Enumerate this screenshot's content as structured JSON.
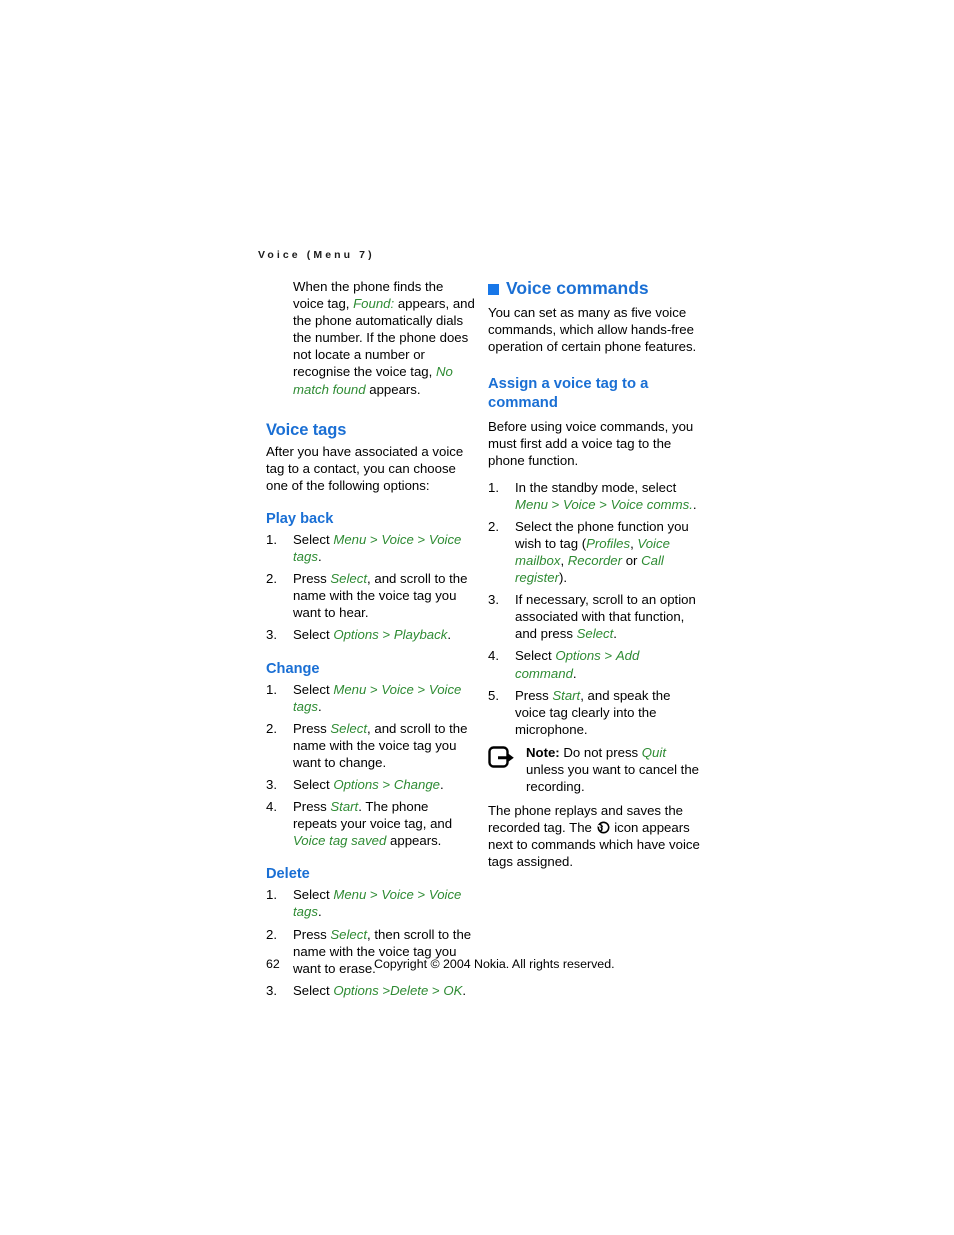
{
  "document": {
    "running_head": "Voice (Menu 7)",
    "page_number": "62",
    "copyright": "Copyright © 2004 Nokia. All rights reserved."
  },
  "colors": {
    "heading_blue": "#1a6fd4",
    "bullet_blue": "#1877e8",
    "ui_term_green": "#2e8b33",
    "body_text": "#000000",
    "page_background": "#ffffff"
  },
  "left_column": {
    "intro_paragraph": {
      "part1": "When the phone finds the voice tag, ",
      "term1": "Found:",
      "part2": " appears, and the phone automatically dials the number. If the phone does not locate a number or recognise the voice tag, ",
      "term2": "No match found",
      "part3": " appears."
    },
    "voice_tags": {
      "heading": "Voice tags",
      "paragraph": "After you have associated a voice tag to a contact, you can choose one of the following options:"
    },
    "play_back": {
      "heading": "Play back",
      "steps": [
        {
          "num": "1.",
          "parts": [
            {
              "text": "Select ",
              "style": "plain"
            },
            {
              "text": "Menu",
              "style": "green"
            },
            {
              "text": " > ",
              "style": "green-plain"
            },
            {
              "text": "Voice",
              "style": "green"
            },
            {
              "text": " > ",
              "style": "green-plain"
            },
            {
              "text": "Voice tags",
              "style": "green"
            },
            {
              "text": ".",
              "style": "plain"
            }
          ]
        },
        {
          "num": "2.",
          "parts": [
            {
              "text": "Press ",
              "style": "plain"
            },
            {
              "text": "Select",
              "style": "green"
            },
            {
              "text": ", and scroll to the name with the voice tag you want to hear.",
              "style": "plain"
            }
          ]
        },
        {
          "num": "3.",
          "parts": [
            {
              "text": "Select ",
              "style": "plain"
            },
            {
              "text": "Options",
              "style": "green"
            },
            {
              "text": " > ",
              "style": "green-plain"
            },
            {
              "text": "Playback",
              "style": "green"
            },
            {
              "text": ".",
              "style": "plain"
            }
          ]
        }
      ]
    },
    "change": {
      "heading": "Change",
      "steps": [
        {
          "num": "1.",
          "parts": [
            {
              "text": "Select ",
              "style": "plain"
            },
            {
              "text": "Menu",
              "style": "green"
            },
            {
              "text": " > ",
              "style": "green-plain"
            },
            {
              "text": "Voice",
              "style": "green"
            },
            {
              "text": " > ",
              "style": "green-plain"
            },
            {
              "text": "Voice tags",
              "style": "green"
            },
            {
              "text": ".",
              "style": "plain"
            }
          ]
        },
        {
          "num": "2.",
          "parts": [
            {
              "text": "Press ",
              "style": "plain"
            },
            {
              "text": "Select",
              "style": "green"
            },
            {
              "text": ", and scroll to the name with the voice tag you want to change.",
              "style": "plain"
            }
          ]
        },
        {
          "num": "3.",
          "parts": [
            {
              "text": "Select ",
              "style": "plain"
            },
            {
              "text": "Options",
              "style": "green"
            },
            {
              "text": " > ",
              "style": "green-plain"
            },
            {
              "text": "Change",
              "style": "green"
            },
            {
              "text": ".",
              "style": "plain"
            }
          ]
        },
        {
          "num": "4.",
          "parts": [
            {
              "text": "Press ",
              "style": "plain"
            },
            {
              "text": "Start",
              "style": "green"
            },
            {
              "text": ". The phone repeats your voice tag, and ",
              "style": "plain"
            },
            {
              "text": "Voice tag saved",
              "style": "green"
            },
            {
              "text": " appears.",
              "style": "plain"
            }
          ]
        }
      ]
    },
    "delete": {
      "heading": "Delete",
      "steps": [
        {
          "num": "1.",
          "parts": [
            {
              "text": "Select ",
              "style": "plain"
            },
            {
              "text": "Menu",
              "style": "green"
            },
            {
              "text": " > ",
              "style": "green-plain"
            },
            {
              "text": "Voice",
              "style": "green"
            },
            {
              "text": " > ",
              "style": "green-plain"
            },
            {
              "text": "Voice tags",
              "style": "green"
            },
            {
              "text": ".",
              "style": "plain"
            }
          ]
        },
        {
          "num": "2.",
          "parts": [
            {
              "text": "Press ",
              "style": "plain"
            },
            {
              "text": "Select",
              "style": "green"
            },
            {
              "text": ", then scroll to the name with the voice tag you want to erase.",
              "style": "plain"
            }
          ]
        },
        {
          "num": "3.",
          "parts": [
            {
              "text": "Select ",
              "style": "plain"
            },
            {
              "text": "Options",
              "style": "green"
            },
            {
              "text": " >",
              "style": "green-plain"
            },
            {
              "text": "Delete",
              "style": "green"
            },
            {
              "text": " > ",
              "style": "green-plain"
            },
            {
              "text": "OK",
              "style": "green"
            },
            {
              "text": ".",
              "style": "plain"
            }
          ]
        }
      ]
    }
  },
  "right_column": {
    "voice_commands": {
      "heading": "Voice commands",
      "bullet_icon": "filled-square-bullet-icon",
      "paragraph": "You can set as many as five voice commands, which allow hands-free operation of certain phone features."
    },
    "assign": {
      "heading": "Assign a voice tag to a command",
      "paragraph": "Before using voice commands, you must first add a voice tag to the phone function.",
      "steps": [
        {
          "num": "1.",
          "parts": [
            {
              "text": "In the standby mode, select ",
              "style": "plain"
            },
            {
              "text": "Menu",
              "style": "green"
            },
            {
              "text": " > ",
              "style": "green-plain"
            },
            {
              "text": "Voice",
              "style": "green"
            },
            {
              "text": " > ",
              "style": "green-plain"
            },
            {
              "text": "Voice comms.",
              "style": "green"
            },
            {
              "text": ".",
              "style": "plain"
            }
          ]
        },
        {
          "num": "2.",
          "parts": [
            {
              "text": "Select the phone function you wish to tag (",
              "style": "plain"
            },
            {
              "text": "Profiles",
              "style": "green"
            },
            {
              "text": ", ",
              "style": "plain"
            },
            {
              "text": "Voice mailbox",
              "style": "green"
            },
            {
              "text": ", ",
              "style": "plain"
            },
            {
              "text": "Recorder",
              "style": "green"
            },
            {
              "text": " or ",
              "style": "plain"
            },
            {
              "text": "Call register",
              "style": "green"
            },
            {
              "text": ").",
              "style": "plain"
            }
          ]
        },
        {
          "num": "3.",
          "parts": [
            {
              "text": "If necessary, scroll to an option associated with that function, and press ",
              "style": "plain"
            },
            {
              "text": "Select",
              "style": "green"
            },
            {
              "text": ".",
              "style": "plain"
            }
          ]
        },
        {
          "num": "4.",
          "parts": [
            {
              "text": "Select ",
              "style": "plain"
            },
            {
              "text": "Options",
              "style": "green"
            },
            {
              "text": " > ",
              "style": "green-plain"
            },
            {
              "text": "Add command",
              "style": "green"
            },
            {
              "text": ".",
              "style": "plain"
            }
          ]
        },
        {
          "num": "5.",
          "parts": [
            {
              "text": "Press ",
              "style": "plain"
            },
            {
              "text": "Start",
              "style": "green"
            },
            {
              "text": ", and speak the voice tag clearly into the microphone.",
              "style": "plain"
            }
          ]
        }
      ],
      "note": {
        "icon": "note-hand-pointer-icon",
        "label": "Note:",
        "text_part1": " Do not press ",
        "term": "Quit",
        "text_part2": " unless you want to cancel the recording."
      },
      "closing_paragraph": {
        "part1": "The phone replays and saves the recorded tag. The ",
        "icon": "voice-tag-icon",
        "part2": " icon appears next to commands which have voice tags assigned."
      }
    }
  }
}
